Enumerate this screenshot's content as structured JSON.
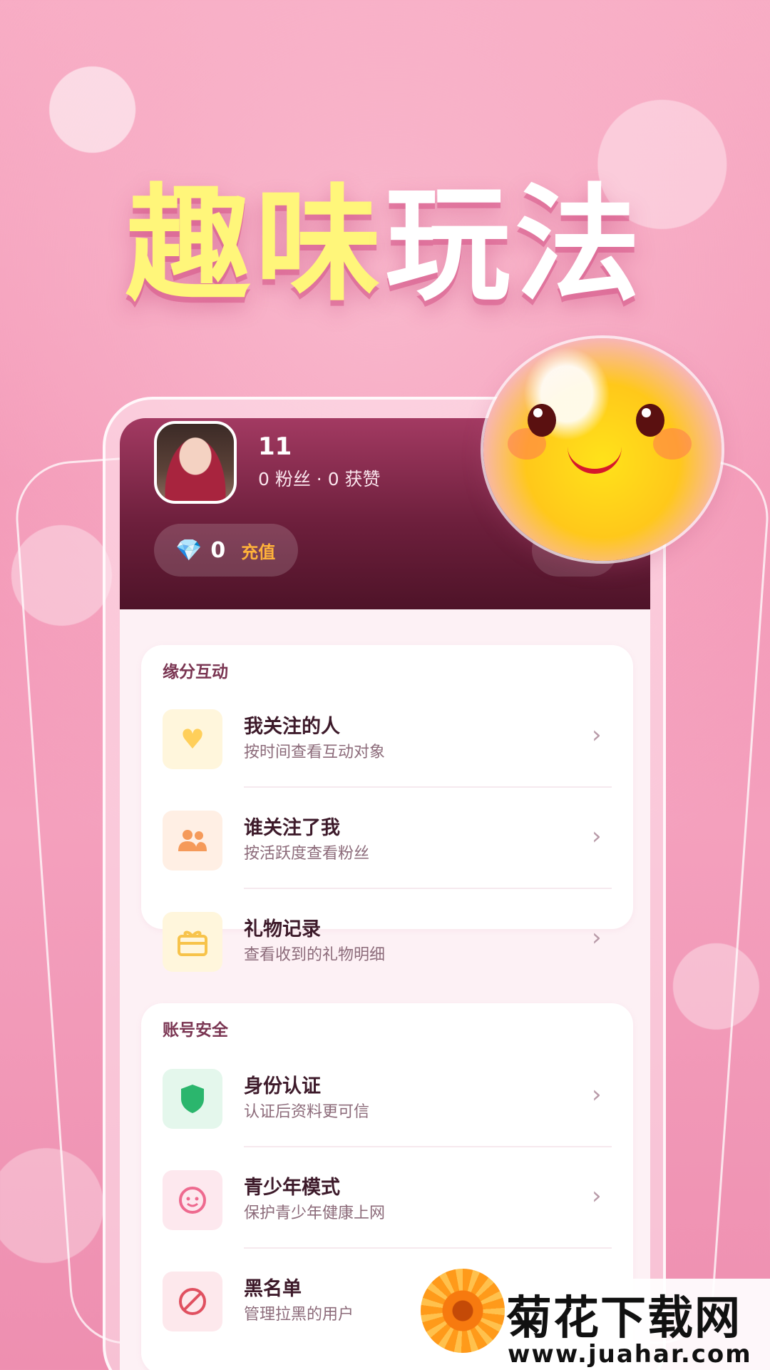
{
  "headline": {
    "part1": "趣味",
    "part2": "玩法"
  },
  "profile": {
    "name": "11",
    "stats": "0 粉丝 · 0 获赞",
    "diamond_icon": "diamond-icon",
    "balance": "0",
    "recharge_label": "充值"
  },
  "sections": [
    {
      "title": "缘分互动",
      "items": [
        {
          "title": "我关注的人",
          "subtitle": "按时间查看互动对象",
          "icon": "heart-icon",
          "icon_color": "#ffcf5a",
          "icon_bg": "#fff6dc"
        },
        {
          "title": "谁关注了我",
          "subtitle": "按活跃度查看粉丝",
          "icon": "people-icon",
          "icon_color": "#f59a5a",
          "icon_bg": "#ffefe4"
        },
        {
          "title": "礼物记录",
          "subtitle": "查看收到的礼物明细",
          "icon": "gift-icon",
          "icon_color": "#f7c34a",
          "icon_bg": "#fff6dc"
        }
      ]
    },
    {
      "title": "账号安全",
      "items": [
        {
          "title": "身份认证",
          "subtitle": "认证后资料更可信",
          "icon": "shield-icon",
          "icon_color": "#2bb66d",
          "icon_bg": "#e4f7ec"
        },
        {
          "title": "青少年模式",
          "subtitle": "保护青少年健康上网",
          "icon": "child-face-icon",
          "icon_color": "#ee6a8f",
          "icon_bg": "#fde8ee"
        },
        {
          "title": "黑名单",
          "subtitle": "管理拉黑的用户",
          "icon": "block-icon",
          "icon_color": "#e05060",
          "icon_bg": "#fde8ec"
        }
      ]
    }
  ],
  "chevron": "›",
  "watermark": {
    "title": "菊花下载网",
    "url": "www.juahar.com"
  }
}
